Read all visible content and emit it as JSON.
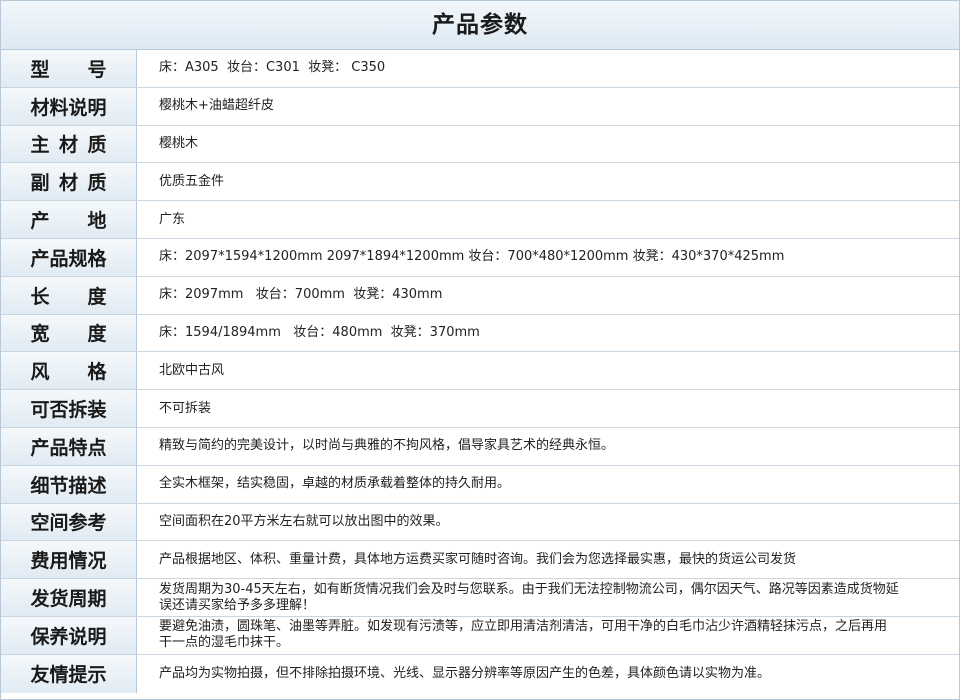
{
  "title": "产品参数",
  "rows": [
    {
      "key": "model",
      "label": "型号",
      "spaced": true,
      "value": "床：A305  妆台：C301  妆凳： C350"
    },
    {
      "key": "material-desc",
      "label": "材料说明",
      "spaced": false,
      "value": "樱桃木+油蜡超纤皮"
    },
    {
      "key": "main-material",
      "label": "主材质",
      "spaced": true,
      "value": "樱桃木"
    },
    {
      "key": "sub-material",
      "label": "副材质",
      "spaced": true,
      "value": "优质五金件"
    },
    {
      "key": "origin",
      "label": "产地",
      "spaced": true,
      "value": "广东"
    },
    {
      "key": "spec",
      "label": "产品规格",
      "spaced": false,
      "value": "床：2097*1594*1200mm  2097*1894*1200mm   妆台：700*480*1200mm  妆凳：430*370*425mm"
    },
    {
      "key": "length",
      "label": "长度",
      "spaced": true,
      "value": "床：2097mm   妆台：700mm  妆凳：430mm"
    },
    {
      "key": "width",
      "label": "宽度",
      "spaced": true,
      "value": "床：1594/1894mm   妆台：480mm  妆凳：370mm"
    },
    {
      "key": "style",
      "label": "风格",
      "spaced": true,
      "value": "北欧中古风"
    },
    {
      "key": "detachable",
      "label": "可否拆装",
      "spaced": false,
      "value": "不可拆装"
    },
    {
      "key": "features",
      "label": "产品特点",
      "spaced": false,
      "value": "精致与简约的完美设计，以时尚与典雅的不拘风格，倡导家具艺术的经典永恒。"
    },
    {
      "key": "details",
      "label": "细节描述",
      "spaced": false,
      "value": "全实木框架，结实稳固，卓越的材质承载着整体的持久耐用。"
    },
    {
      "key": "space",
      "label": "空间参考",
      "spaced": false,
      "value": "空间面积在20平方米左右就可以放出图中的效果。"
    },
    {
      "key": "cost",
      "label": "费用情况",
      "spaced": false,
      "value": "产品根据地区、体积、重量计费，具体地方运费买家可随时咨询。我们会为您选择最实惠，最快的货运公司发货"
    },
    {
      "key": "shipping",
      "label": "发货周期",
      "spaced": false,
      "value": "发货周期为30-45天左右，如有断货情况我们会及时与您联系。由于我们无法控制物流公司，偶尔因天气、路况等因素造成货物延误还请买家给予多多理解！"
    },
    {
      "key": "care",
      "label": "保养说明",
      "spaced": false,
      "value": "要避免油渍，圆珠笔、油墨等弄脏。如发现有污渍等，应立即用清洁剂清洁，可用干净的白毛巾沾少许酒精轻抹污点，之后再用干一点的湿毛巾抹干。"
    },
    {
      "key": "notice",
      "label": "友情提示",
      "spaced": false,
      "value": "产品均为实物拍摄，但不排除拍摄环境、光线、显示器分辨率等原因产生的色差，具体颜色请以实物为准。"
    }
  ]
}
